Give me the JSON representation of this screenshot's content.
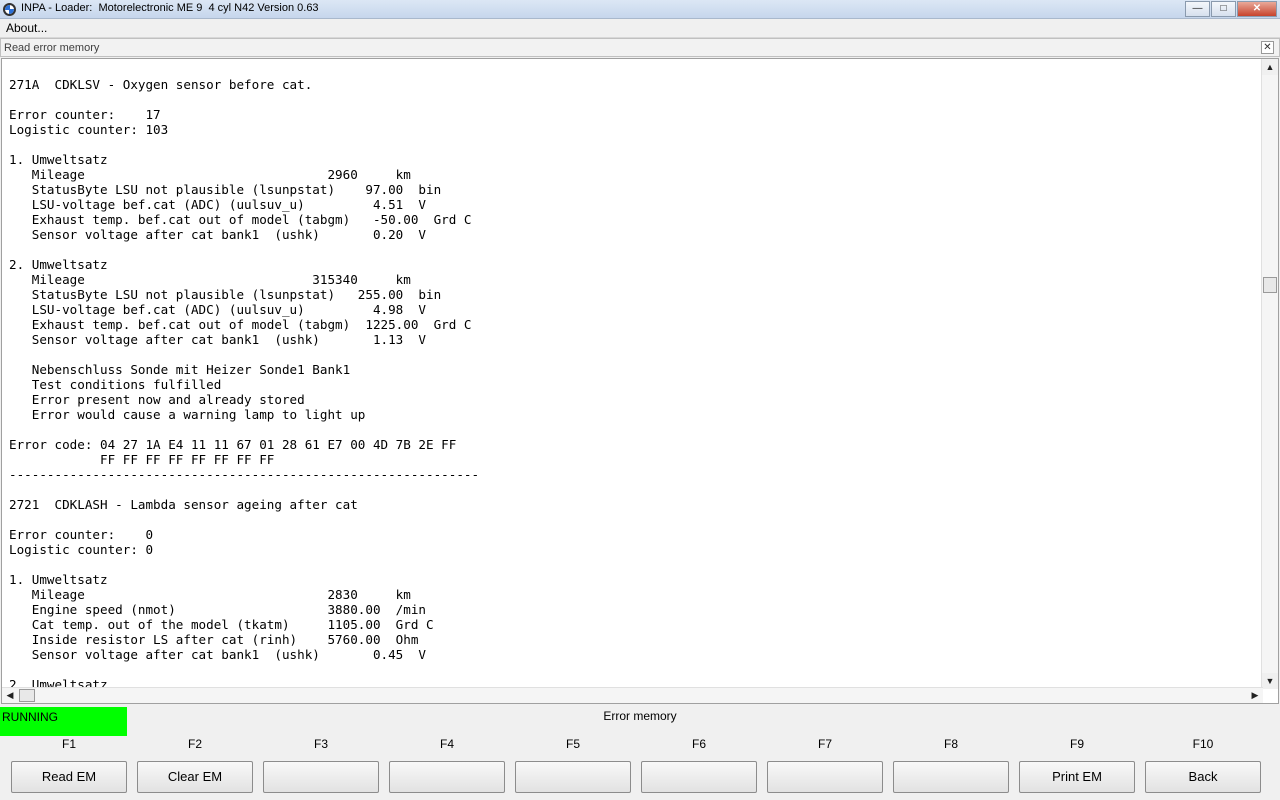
{
  "window": {
    "title": "INPA - Loader:  Motorelectronic ME 9  4 cyl N42 Version 0.63",
    "minimize_icon": "minimize-icon",
    "maximize_icon": "maximize-icon",
    "close_icon": "close-icon"
  },
  "menu": {
    "about": "About..."
  },
  "panel": {
    "title": "Read error memory"
  },
  "content_lines": [
    "",
    "271A  CDKLSV - Oxygen sensor before cat.",
    "",
    "Error counter:    17",
    "Logistic counter: 103",
    "",
    "1. Umweltsatz",
    "   Mileage                                2960     km",
    "   StatusByte LSU not plausible (lsunpstat)    97.00  bin",
    "   LSU-voltage bef.cat (ADC) (uulsuv_u)         4.51  V",
    "   Exhaust temp. bef.cat out of model (tabgm)   -50.00  Grd C",
    "   Sensor voltage after cat bank1  (ushk)       0.20  V",
    "",
    "2. Umweltsatz",
    "   Mileage                              315340     km",
    "   StatusByte LSU not plausible (lsunpstat)   255.00  bin",
    "   LSU-voltage bef.cat (ADC) (uulsuv_u)         4.98  V",
    "   Exhaust temp. bef.cat out of model (tabgm)  1225.00  Grd C",
    "   Sensor voltage after cat bank1  (ushk)       1.13  V",
    "",
    "   Nebenschluss Sonde mit Heizer Sonde1 Bank1",
    "   Test conditions fulfilled",
    "   Error present now and already stored",
    "   Error would cause a warning lamp to light up",
    "",
    "Error code: 04 27 1A E4 11 11 67 01 28 61 E7 00 4D 7B 2E FF",
    "            FF FF FF FF FF FF FF FF",
    "--------------------------------------------------------------",
    "",
    "2721  CDKLASH - Lambda sensor ageing after cat",
    "",
    "Error counter:    0",
    "Logistic counter: 0",
    "",
    "1. Umweltsatz",
    "   Mileage                                2830     km",
    "   Engine speed (nmot)                    3880.00  /min",
    "   Cat temp. out of the model (tkatm)     1105.00  Grd C",
    "   Inside resistor LS after cat (rinh)    5760.00  Ohm",
    "   Sensor voltage after cat bank1  (ushk)       0.45  V",
    "",
    "2. Umweltsatz"
  ],
  "status": {
    "state": "RUNNING",
    "color": "#00ff00",
    "section": "Error memory"
  },
  "function_keys": [
    {
      "key": "F1",
      "label": "Read EM"
    },
    {
      "key": "F2",
      "label": "Clear EM"
    },
    {
      "key": "F3",
      "label": ""
    },
    {
      "key": "F4",
      "label": ""
    },
    {
      "key": "F5",
      "label": ""
    },
    {
      "key": "F6",
      "label": ""
    },
    {
      "key": "F7",
      "label": ""
    },
    {
      "key": "F8",
      "label": ""
    },
    {
      "key": "F9",
      "label": "Print EM"
    },
    {
      "key": "F10",
      "label": "Back"
    }
  ]
}
